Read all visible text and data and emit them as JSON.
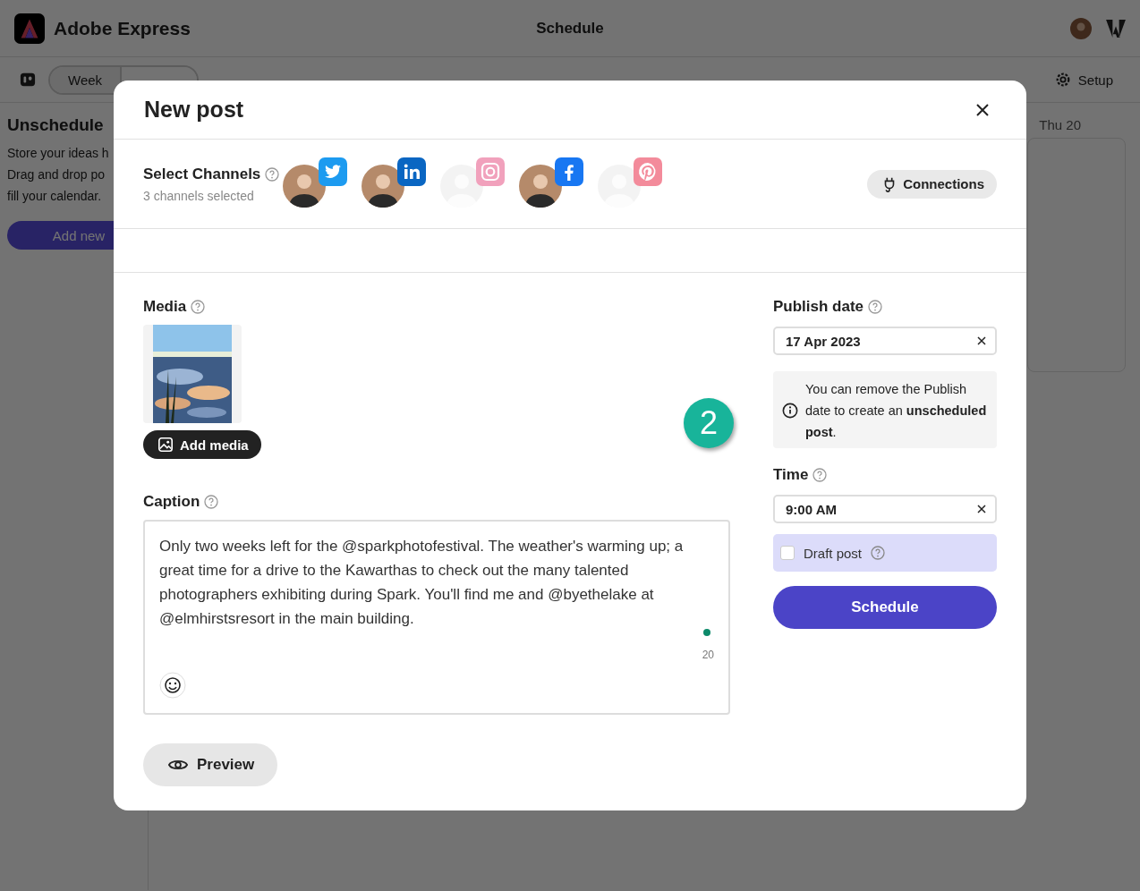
{
  "app": {
    "name": "Adobe Express",
    "page_title": "Schedule"
  },
  "toolbar": {
    "week": "Week",
    "setup": "Setup"
  },
  "sidebar": {
    "title": "Unschedule",
    "lines": [
      "Store your ideas h",
      "Drag and drop po",
      "fill your calendar."
    ],
    "add_new": "Add new"
  },
  "calendar": {
    "day_header": "Thu 20"
  },
  "dialog": {
    "title": "New post",
    "channels_label": "Select Channels",
    "channels_count": "3 channels selected",
    "channels": [
      {
        "kind": "twitter",
        "selected": true
      },
      {
        "kind": "linkedin",
        "selected": true
      },
      {
        "kind": "instagram",
        "selected": false
      },
      {
        "kind": "facebook",
        "selected": true
      },
      {
        "kind": "pinterest",
        "selected": false
      }
    ],
    "connections": "Connections",
    "media_label": "Media",
    "add_media": "Add media",
    "step_marker": "2",
    "caption_label": "Caption",
    "caption": "Only two weeks left for the @sparkphotofestival. The weather's warming up; a great time for a drive to the Kawarthas to check out the many talented photographers exhibiting during Spark. You'll find me and @byethelake at @elmhirstsresort in the main building.",
    "counter": "20",
    "preview": "Preview",
    "publish_label": "Publish date",
    "publish_date": "17 Apr 2023",
    "info": "You can remove the Publish date to create an **unscheduled post**.",
    "time_label": "Time",
    "time": "9:00 AM",
    "draft": {
      "label": "Draft post",
      "checked": false
    },
    "schedule": "Schedule"
  }
}
